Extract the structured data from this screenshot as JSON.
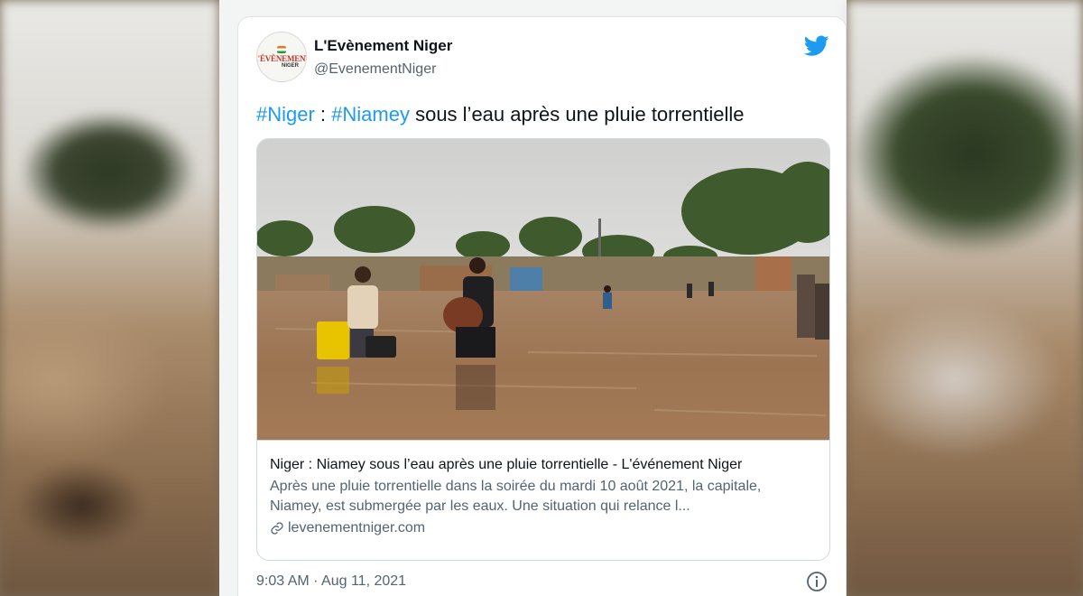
{
  "tweet": {
    "display_name": "L'Evènement Niger",
    "handle": "@EvenementNiger",
    "avatar": {
      "logo_line1": "L'ÉVÈNEMENT",
      "logo_line2": "NIGER"
    },
    "text": {
      "hashtag1": "#Niger",
      "sep": " : ",
      "hashtag2": "#Niamey",
      "rest": " sous l’eau après une pluie torrentielle"
    },
    "card": {
      "title": "Niger : Niamey sous l’eau après une pluie torrentielle - L'événement Niger",
      "description": "Après une pluie torrentielle dans la soirée du mardi 10 août 2021, la capitale, Niamey, est submergée par les eaux. Une situation qui relance l...",
      "domain": "levenementniger.com"
    },
    "timestamp": "9:03 AM · Aug 11, 2021"
  },
  "icons": {
    "brand": "twitter-bird-icon",
    "link": "link-icon",
    "info": "info-icon"
  },
  "colors": {
    "accent": "#1d9bf0",
    "text_primary": "#0f1419",
    "text_secondary": "#536471"
  }
}
